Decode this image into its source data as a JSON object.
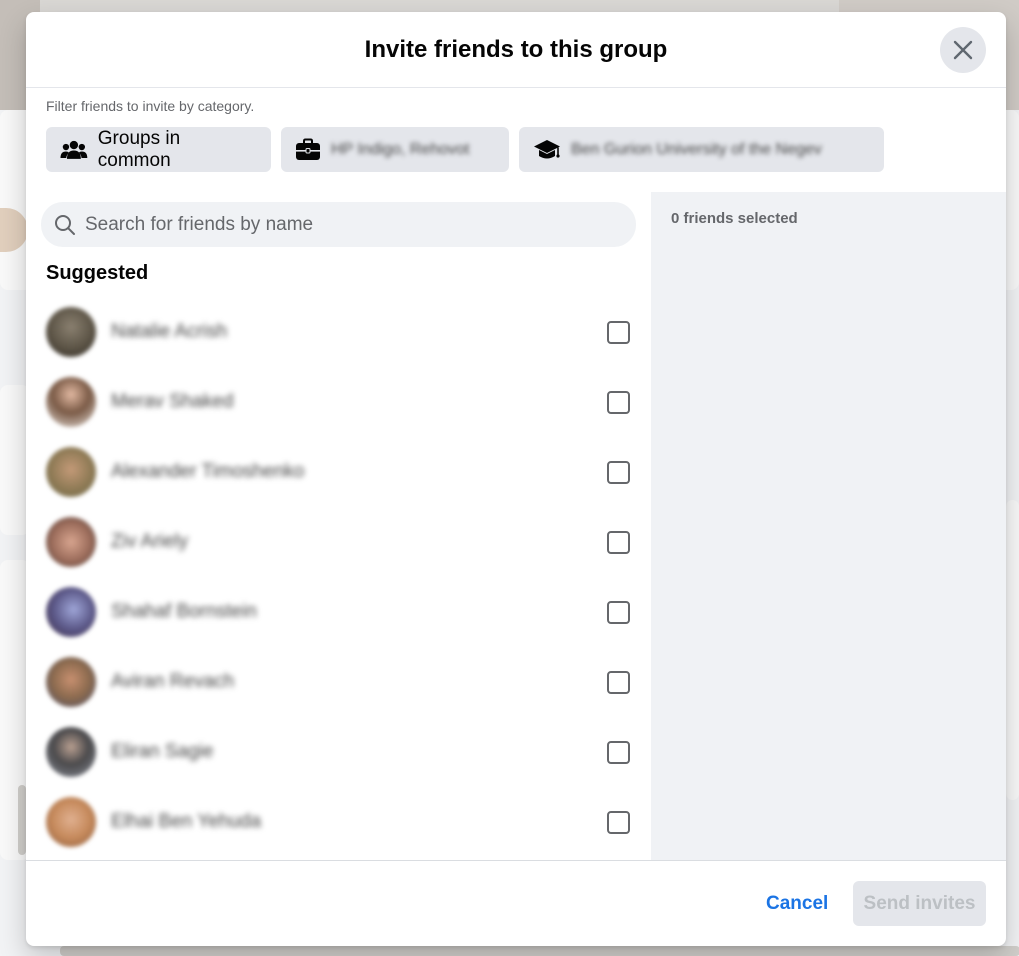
{
  "modal": {
    "title": "Invite friends to this group"
  },
  "filter": {
    "label": "Filter friends to invite by category.",
    "chips": [
      {
        "label": "Groups in common",
        "icon": "people-group-icon"
      },
      {
        "label": "HP Indigo, Rehovot",
        "icon": "briefcase-icon"
      },
      {
        "label": "Ben Gurion University of the Negev",
        "icon": "graduation-cap-icon"
      }
    ]
  },
  "search": {
    "placeholder": "Search for friends by name"
  },
  "suggested": {
    "title": "Suggested",
    "friends": [
      {
        "name": "Natalie Acrish",
        "avatar_color": "#5c5446"
      },
      {
        "name": "Merav Shaked",
        "avatar_color": "#7a5a46"
      },
      {
        "name": "Alexander Timoshenko",
        "avatar_color": "#8e7a55"
      },
      {
        "name": "Ziv Ariely",
        "avatar_color": "#9a6b5a"
      },
      {
        "name": "Shahaf Bornstein",
        "avatar_color": "#5d5a8a"
      },
      {
        "name": "Aviran Revach",
        "avatar_color": "#8b6a4e"
      },
      {
        "name": "Eliran Sagie",
        "avatar_color": "#4b4a4c"
      },
      {
        "name": "Elhai Ben Yehuda",
        "avatar_color": "#c68a5c"
      }
    ]
  },
  "selection": {
    "count_label": "0 friends selected"
  },
  "footer": {
    "cancel_label": "Cancel",
    "send_label": "Send invites"
  },
  "colors": {
    "accent": "#1b74e4",
    "chip_bg": "#e4e6eb",
    "pane_bg": "#f0f2f5"
  }
}
